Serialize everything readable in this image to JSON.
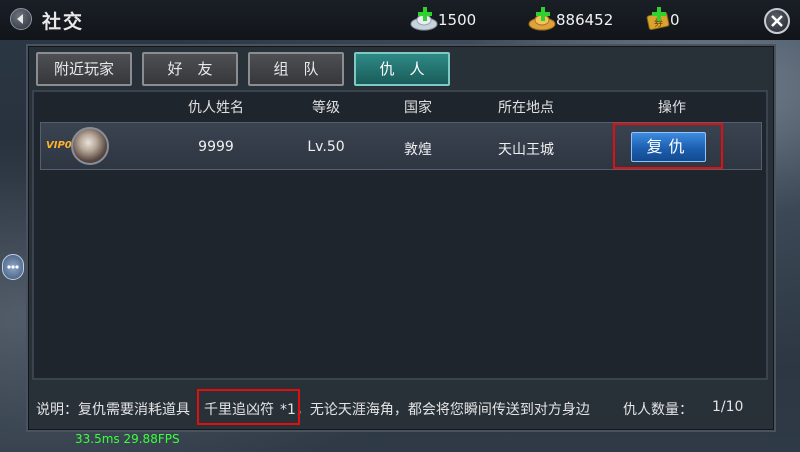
{
  "header": {
    "title": "社交",
    "currencies": [
      {
        "icon": "silver-ingot-icon",
        "value": "1500"
      },
      {
        "icon": "gold-ingot-icon",
        "value": "886452"
      },
      {
        "icon": "coupon-icon",
        "value": "0"
      }
    ]
  },
  "tabs": [
    {
      "label": "附近玩家",
      "active": false
    },
    {
      "label": "好　友",
      "active": false
    },
    {
      "label": "组　队",
      "active": false
    },
    {
      "label": "仇　人",
      "active": true
    }
  ],
  "table": {
    "headers": [
      "仇人姓名",
      "等级",
      "国家",
      "所在地点",
      "操作"
    ],
    "rows": [
      {
        "vip": "VIP0",
        "name": "9999",
        "level": "Lv.50",
        "country": "敦煌",
        "location": "天山王城",
        "action": "复仇"
      }
    ]
  },
  "footer": {
    "prefix": "说明：复仇需要消耗道具",
    "item": "千里追凶符",
    "suffix": "*1，无论天涯海角，都会将您瞬间传送到对方身边",
    "count_label": "仇人数量：",
    "count_value": "1/10"
  },
  "debug": {
    "fps_text": "33.5ms 29.88FPS"
  },
  "colors": {
    "accent_teal": "#2e8a86",
    "button_blue": "#1c5fb0",
    "item_green": "#3ce04a",
    "highlight_red": "#e01010"
  }
}
